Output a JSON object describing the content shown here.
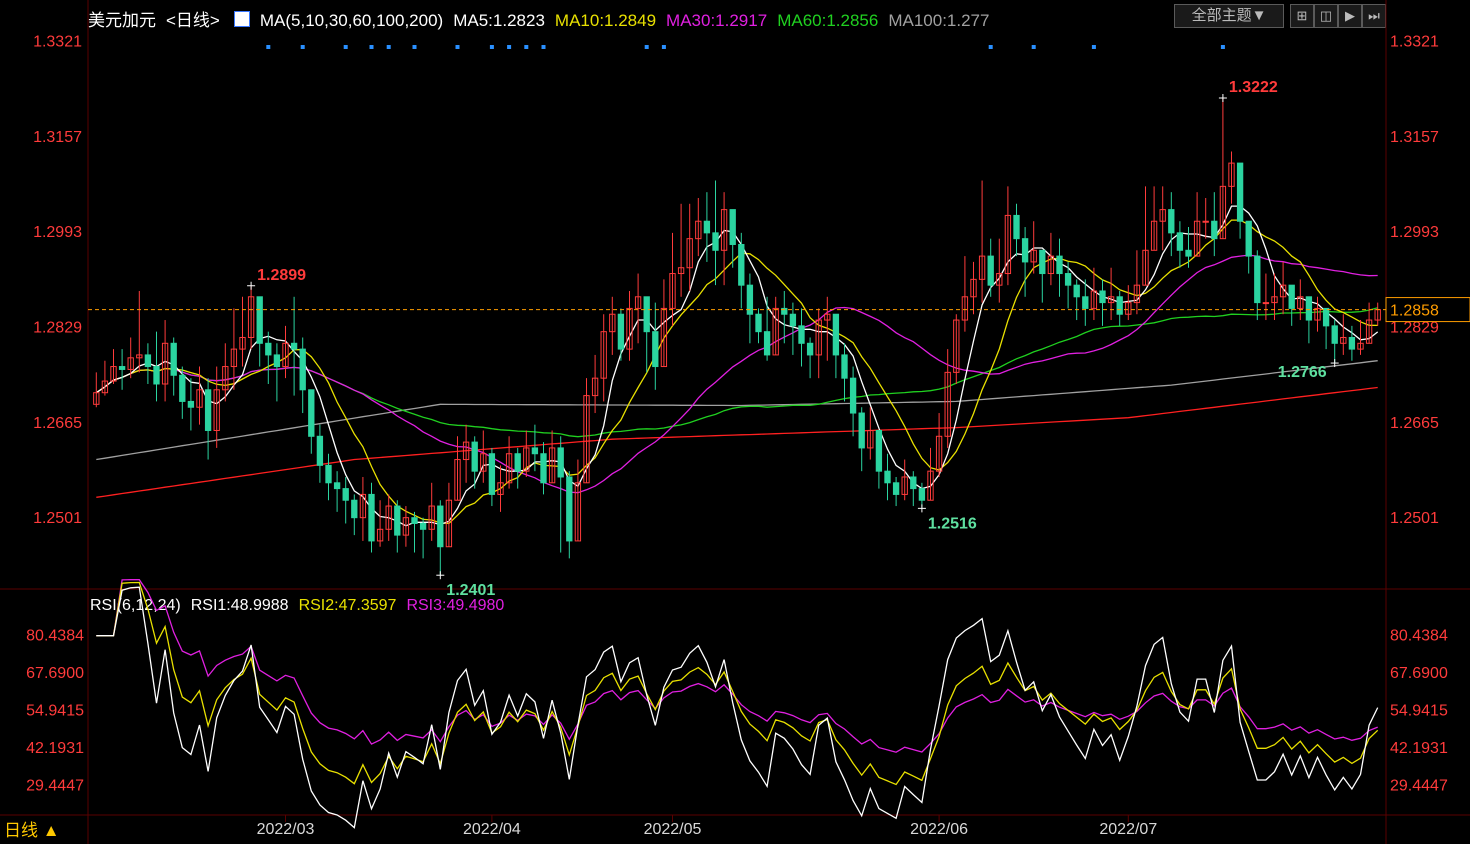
{
  "header": {
    "symbol": "美元加元",
    "period": "<日线>",
    "ma_label": "MA(5,10,30,60,100,200)",
    "ma5": "MA5:1.2823",
    "ma10": "MA10:1.2849",
    "ma30": "MA30:1.2917",
    "ma60": "MA60:1.2856",
    "ma100": "MA100:1.277"
  },
  "toolbar": {
    "theme_button": "全部主题▼"
  },
  "rsi_header": {
    "label": "RSI(6,12,24)",
    "rsi1": "RSI1:48.9988",
    "rsi2": "RSI2:47.3597",
    "rsi3": "RSI3:49.4980"
  },
  "period_tab": "日线 ▲",
  "colors": {
    "up": "#ff3b3b",
    "down": "#2bd4a0",
    "ma5": "#ffffff",
    "ma10": "#e8e000",
    "ma30": "#e020e0",
    "ma60": "#20d020",
    "ma100": "#a0a0a0",
    "ma200": "#ff2020",
    "axis_text": "#ff3b3b",
    "grid": "#333333",
    "current_price": "#ff9d00"
  },
  "chart_data": [
    {
      "type": "candlestick",
      "ylim": [
        1.2379,
        1.3339
      ],
      "y_ticks": [
        "1.3321",
        "1.3157",
        "1.2993",
        "1.2829",
        "1.2665",
        "1.2501"
      ],
      "x_ticks": [
        "2022/03",
        "2022/04",
        "2022/05",
        "2022/06",
        "2022/07"
      ],
      "current_price": "1.2858",
      "annotations": [
        {
          "text": "1.2899",
          "value": 1.2899,
          "kind": "high"
        },
        {
          "text": "1.2401",
          "value": 1.2401,
          "kind": "low"
        },
        {
          "text": "1.3222",
          "value": 1.3222,
          "kind": "high"
        },
        {
          "text": "1.2516",
          "value": 1.2516,
          "kind": "low"
        },
        {
          "text": "1.2766",
          "value": 1.2766,
          "kind": "low"
        }
      ],
      "closes": [
        1.2715,
        1.2735,
        1.276,
        1.2755,
        1.2775,
        1.278,
        1.276,
        1.273,
        1.28,
        1.2745,
        1.27,
        1.269,
        1.272,
        1.265,
        1.272,
        1.276,
        1.279,
        1.281,
        1.288,
        1.28,
        1.278,
        1.276,
        1.28,
        1.279,
        1.272,
        1.264,
        1.259,
        1.256,
        1.255,
        1.253,
        1.25,
        1.254,
        1.246,
        1.248,
        1.252,
        1.247,
        1.25,
        1.249,
        1.248,
        1.252,
        1.245,
        1.253,
        1.26,
        1.263,
        1.258,
        1.261,
        1.254,
        1.256,
        1.261,
        1.258,
        1.262,
        1.261,
        1.256,
        1.262,
        1.257,
        1.246,
        1.256,
        1.271,
        1.274,
        1.282,
        1.285,
        1.279,
        1.286,
        1.288,
        1.282,
        1.276,
        1.286,
        1.292,
        1.293,
        1.298,
        1.301,
        1.299,
        1.296,
        1.303,
        1.297,
        1.29,
        1.285,
        1.282,
        1.278,
        1.286,
        1.285,
        1.283,
        1.28,
        1.278,
        1.284,
        1.285,
        1.278,
        1.274,
        1.268,
        1.262,
        1.265,
        1.258,
        1.256,
        1.254,
        1.257,
        1.255,
        1.253,
        1.258,
        1.264,
        1.275,
        1.284,
        1.288,
        1.291,
        1.295,
        1.29,
        1.292,
        1.302,
        1.298,
        1.294,
        1.296,
        1.292,
        1.295,
        1.292,
        1.29,
        1.288,
        1.286,
        1.289,
        1.287,
        1.288,
        1.285,
        1.287,
        1.29,
        1.296,
        1.301,
        1.303,
        1.299,
        1.296,
        1.295,
        1.301,
        1.301,
        1.298,
        1.307,
        1.311,
        1.301,
        1.295,
        1.287,
        1.287,
        1.288,
        1.29,
        1.286,
        1.288,
        1.284,
        1.286,
        1.283,
        1.28,
        1.281,
        1.279,
        1.28,
        1.284,
        1.2858
      ],
      "ranges": [
        [
          1.269,
          1.275
        ],
        [
          1.271,
          1.277
        ],
        [
          1.273,
          1.279
        ],
        [
          1.272,
          1.279
        ],
        [
          1.274,
          1.281
        ],
        [
          1.275,
          1.289
        ],
        [
          1.273,
          1.28
        ],
        [
          1.27,
          1.282
        ],
        [
          1.27,
          1.284
        ],
        [
          1.271,
          1.281
        ],
        [
          1.267,
          1.276
        ],
        [
          1.265,
          1.274
        ],
        [
          1.266,
          1.276
        ],
        [
          1.26,
          1.274
        ],
        [
          1.262,
          1.276
        ],
        [
          1.27,
          1.28
        ],
        [
          1.272,
          1.286
        ],
        [
          1.276,
          1.288
        ],
        [
          1.279,
          1.2899
        ],
        [
          1.276,
          1.288
        ],
        [
          1.273,
          1.282
        ],
        [
          1.27,
          1.28
        ],
        [
          1.274,
          1.283
        ],
        [
          1.271,
          1.288
        ],
        [
          1.268,
          1.281
        ],
        [
          1.261,
          1.272
        ],
        [
          1.256,
          1.266
        ],
        [
          1.253,
          1.261
        ],
        [
          1.251,
          1.258
        ],
        [
          1.249,
          1.257
        ],
        [
          1.247,
          1.254
        ],
        [
          1.246,
          1.257
        ],
        [
          1.244,
          1.256
        ],
        [
          1.245,
          1.253
        ],
        [
          1.246,
          1.254
        ],
        [
          1.244,
          1.253
        ],
        [
          1.245,
          1.252
        ],
        [
          1.244,
          1.251
        ],
        [
          1.243,
          1.25
        ],
        [
          1.246,
          1.256
        ],
        [
          1.2401,
          1.253
        ],
        [
          1.245,
          1.256
        ],
        [
          1.253,
          1.264
        ],
        [
          1.256,
          1.266
        ],
        [
          1.255,
          1.264
        ],
        [
          1.256,
          1.265
        ],
        [
          1.252,
          1.262
        ],
        [
          1.251,
          1.259
        ],
        [
          1.255,
          1.264
        ],
        [
          1.255,
          1.262
        ],
        [
          1.257,
          1.265
        ],
        [
          1.258,
          1.266
        ],
        [
          1.254,
          1.263
        ],
        [
          1.256,
          1.265
        ],
        [
          1.244,
          1.264
        ],
        [
          1.243,
          1.258
        ],
        [
          1.252,
          1.26
        ],
        [
          1.256,
          1.274
        ],
        [
          1.268,
          1.278
        ],
        [
          1.27,
          1.285
        ],
        [
          1.278,
          1.288
        ],
        [
          1.277,
          1.286
        ],
        [
          1.277,
          1.289
        ],
        [
          1.28,
          1.292
        ],
        [
          1.275,
          1.288
        ],
        [
          1.272,
          1.287
        ],
        [
          1.276,
          1.291
        ],
        [
          1.283,
          1.299
        ],
        [
          1.288,
          1.304
        ],
        [
          1.289,
          1.304
        ],
        [
          1.295,
          1.305
        ],
        [
          1.294,
          1.306
        ],
        [
          1.29,
          1.308
        ],
        [
          1.29,
          1.306
        ],
        [
          1.293,
          1.303
        ],
        [
          1.286,
          1.299
        ],
        [
          1.28,
          1.292
        ],
        [
          1.28,
          1.286
        ],
        [
          1.277,
          1.288
        ],
        [
          1.278,
          1.288
        ],
        [
          1.28,
          1.289
        ],
        [
          1.278,
          1.287
        ],
        [
          1.276,
          1.286
        ],
        [
          1.274,
          1.281
        ],
        [
          1.274,
          1.286
        ],
        [
          1.277,
          1.288
        ],
        [
          1.274,
          1.285
        ],
        [
          1.27,
          1.28
        ],
        [
          1.264,
          1.276
        ],
        [
          1.258,
          1.269
        ],
        [
          1.26,
          1.269
        ],
        [
          1.255,
          1.265
        ],
        [
          1.253,
          1.261
        ],
        [
          1.252,
          1.257
        ],
        [
          1.253,
          1.26
        ],
        [
          1.252,
          1.258
        ],
        [
          1.2516,
          1.256
        ],
        [
          1.253,
          1.262
        ],
        [
          1.257,
          1.268
        ],
        [
          1.262,
          1.279
        ],
        [
          1.273,
          1.285
        ],
        [
          1.282,
          1.295
        ],
        [
          1.285,
          1.294
        ],
        [
          1.287,
          1.308
        ],
        [
          1.288,
          1.298
        ],
        [
          1.287,
          1.298
        ],
        [
          1.29,
          1.307
        ],
        [
          1.295,
          1.304
        ],
        [
          1.288,
          1.3
        ],
        [
          1.292,
          1.301
        ],
        [
          1.287,
          1.296
        ],
        [
          1.29,
          1.299
        ],
        [
          1.288,
          1.298
        ],
        [
          1.286,
          1.294
        ],
        [
          1.284,
          1.291
        ],
        [
          1.283,
          1.291
        ],
        [
          1.284,
          1.293
        ],
        [
          1.283,
          1.291
        ],
        [
          1.284,
          1.293
        ],
        [
          1.283,
          1.289
        ],
        [
          1.284,
          1.29
        ],
        [
          1.285,
          1.296
        ],
        [
          1.29,
          1.307
        ],
        [
          1.296,
          1.307
        ],
        [
          1.296,
          1.307
        ],
        [
          1.295,
          1.306
        ],
        [
          1.293,
          1.301
        ],
        [
          1.293,
          1.3
        ],
        [
          1.298,
          1.306
        ],
        [
          1.298,
          1.305
        ],
        [
          1.295,
          1.306
        ],
        [
          1.302,
          1.3222
        ],
        [
          1.304,
          1.313
        ],
        [
          1.298,
          1.311
        ],
        [
          1.292,
          1.301
        ],
        [
          1.284,
          1.296
        ],
        [
          1.284,
          1.292
        ],
        [
          1.284,
          1.292
        ],
        [
          1.285,
          1.294
        ],
        [
          1.283,
          1.29
        ],
        [
          1.284,
          1.291
        ],
        [
          1.28,
          1.287
        ],
        [
          1.282,
          1.288
        ],
        [
          1.279,
          1.286
        ],
        [
          1.2766,
          1.284
        ],
        [
          1.278,
          1.285
        ],
        [
          1.277,
          1.283
        ],
        [
          1.278,
          1.284
        ],
        [
          1.28,
          1.287
        ],
        [
          1.283,
          1.287
        ]
      ],
      "ma100_points": [
        [
          0,
          1.26
        ],
        [
          40,
          1.2695
        ],
        [
          75,
          1.2693
        ],
        [
          100,
          1.27
        ],
        [
          125,
          1.2728
        ],
        [
          149,
          1.277
        ]
      ],
      "ma200_points": [
        [
          0,
          1.2535
        ],
        [
          30,
          1.26
        ],
        [
          60,
          1.2635
        ],
        [
          100,
          1.2655
        ],
        [
          120,
          1.2672
        ],
        [
          149,
          1.2724
        ]
      ]
    },
    {
      "type": "line",
      "title": "RSI(6,12,24)",
      "ylim": [
        19.5,
        86
      ],
      "y_ticks": [
        "80.4384",
        "67.6900",
        "54.9415",
        "42.1931",
        "29.4447"
      ],
      "series": [
        {
          "name": "RSI1",
          "last": 48.9988
        },
        {
          "name": "RSI2",
          "last": 47.3597
        },
        {
          "name": "RSI3",
          "last": 49.498
        }
      ]
    }
  ]
}
